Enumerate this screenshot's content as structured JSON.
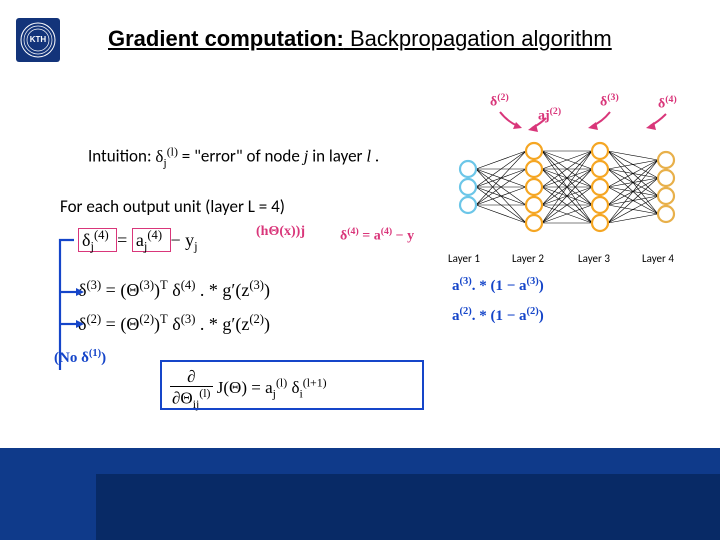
{
  "title": {
    "bold": "Gradient computation:",
    "rest": " Backpropagation algorithm"
  },
  "text": {
    "intuition_pre": "Intuition: ",
    "intuition_post": " = \"error\" of node ",
    "intuition_post2": " in layer ",
    "intuition_post3": ".",
    "delta_lj": "δ",
    "j": "j",
    "l": "l",
    "foreach": "For each output unit (layer L = 4)",
    "eq4_lhs": "δ",
    "eq4_sub": "j",
    "eq4_sup": "(4)",
    "eq4_eq": " = ",
    "eq4_a": "a",
    "eq4_asub": "j",
    "eq4_asup": "(4)",
    "eq4_min": " − ",
    "eq4_y": "y",
    "eq4_ysub": "j",
    "h_theta": "(hΘ(x))j",
    "d4": "  δ",
    "d4rest": " = a",
    "d4rest2": " − y",
    "eq3_a": "δ",
    "eq3_sup": "(3)",
    "eq3_mid": " = (Θ",
    "eq3_mid2": ")",
    "eq3_T": "T",
    "eq3_d": "δ",
    "eq3_d4": "(4)",
    "eq3_g": ". * g′(z",
    "eq3_gs": "(3)",
    "eq3_end": ")",
    "eq2_a": "δ",
    "eq2_sup": "(2)",
    "eq2_mid": " = (Θ",
    "eq2_mid2": ")",
    "eq2_T": "T",
    "eq2_d": "δ",
    "eq2_d3": "(3)",
    "eq2_g": ". * g′(z",
    "eq2_gs": "(2)",
    "eq2_end": ")",
    "no_d1": "(No  δ",
    "no_d1s": "(1)",
    "no_d1e": ")",
    "partial_num": "∂",
    "partial_den": "∂Θ",
    "partial_densub": "ij",
    "partial_densup": "(l)",
    "J": " J(Θ) = ",
    "rhs_a": "a",
    "rhs_asub": "j",
    "rhs_asup": "(l)",
    "rhs_d": "δ",
    "rhs_dsub": "i",
    "rhs_dsup": "(l+1)",
    "gprime_ex1a": "a",
    "gprime_ex1b": ". * (1 − a",
    "gprime_ex1c": ")",
    "gprime_ex2a": "a",
    "gprime_ex2b": ". * (1 − a",
    "gprime_ex2c": ")",
    "sup3": "(3)",
    "sup2": "(2)",
    "d2lab": "δ",
    "d2sup": "(2)",
    "ajlab": "aj",
    "d3lab": "δ",
    "d3sup": "(3)",
    "d4lab": "δ",
    "d4sup": "(4)"
  },
  "layers": [
    "Layer 1",
    "Layer 2",
    "Layer 3",
    "Layer 4"
  ],
  "nn": {
    "layer_counts": [
      3,
      5,
      5,
      4
    ],
    "colors": [
      "#6cc6e8",
      "#f5a623",
      "#f5a623",
      "#e8b04a"
    ]
  }
}
